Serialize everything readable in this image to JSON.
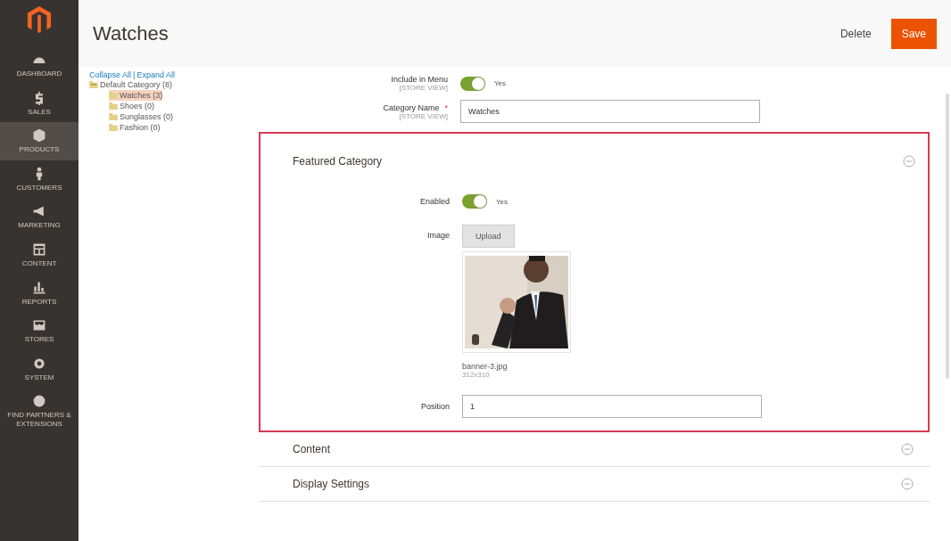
{
  "sidebar": {
    "items": [
      {
        "kind": "dashboard",
        "label": "DASHBOARD",
        "selected": false
      },
      {
        "kind": "sales",
        "label": "SALES",
        "selected": false
      },
      {
        "kind": "products",
        "label": "PRODUCTS",
        "selected": true
      },
      {
        "kind": "customers",
        "label": "CUSTOMERS",
        "selected": false
      },
      {
        "kind": "marketing",
        "label": "MARKETING",
        "selected": false
      },
      {
        "kind": "content",
        "label": "CONTENT",
        "selected": false
      },
      {
        "kind": "reports",
        "label": "REPORTS",
        "selected": false
      },
      {
        "kind": "stores",
        "label": "STORES",
        "selected": false
      },
      {
        "kind": "system",
        "label": "SYSTEM",
        "selected": false
      },
      {
        "kind": "partners",
        "label": "FIND PARTNERS & EXTENSIONS",
        "selected": false
      }
    ]
  },
  "header": {
    "title": "Watches",
    "buttons": [
      {
        "kind": "secondary",
        "label": "Delete"
      },
      {
        "kind": "primary",
        "label": "Save"
      }
    ]
  },
  "tree": {
    "collapse": "Collapse All",
    "separator": "|",
    "expand": "Expand All",
    "root": {
      "label": "Default Category (8)",
      "expanded": true,
      "selected": false,
      "children": [
        {
          "label": "Watches (3)",
          "selected": true
        },
        {
          "label": "Shoes (0)",
          "selected": false
        },
        {
          "label": "Sunglasses (0)",
          "selected": false
        },
        {
          "label": "Fashion (0)",
          "selected": false
        }
      ]
    }
  },
  "fields": [
    {
      "kind": "toggle",
      "label": "Include in Menu",
      "scope": "[STORE VIEW]",
      "on": true,
      "value": "Yes"
    },
    {
      "kind": "text",
      "label": "Category Name",
      "required_mark": "*",
      "scope": "[STORE VIEW]",
      "value": "Watches"
    }
  ],
  "featured": {
    "title": "Featured Category",
    "highlighted": true,
    "fields": [
      {
        "kind": "toggle",
        "label": "Enabled",
        "on": true,
        "value": "Yes"
      },
      {
        "label": "Image",
        "button": "Upload",
        "file": "banner-3.jpg",
        "size": "312x310"
      },
      {
        "kind": "text",
        "label": "Position",
        "value": "1"
      }
    ]
  },
  "sections": [
    {
      "title": "Content"
    },
    {
      "title": "Display Settings"
    }
  ]
}
